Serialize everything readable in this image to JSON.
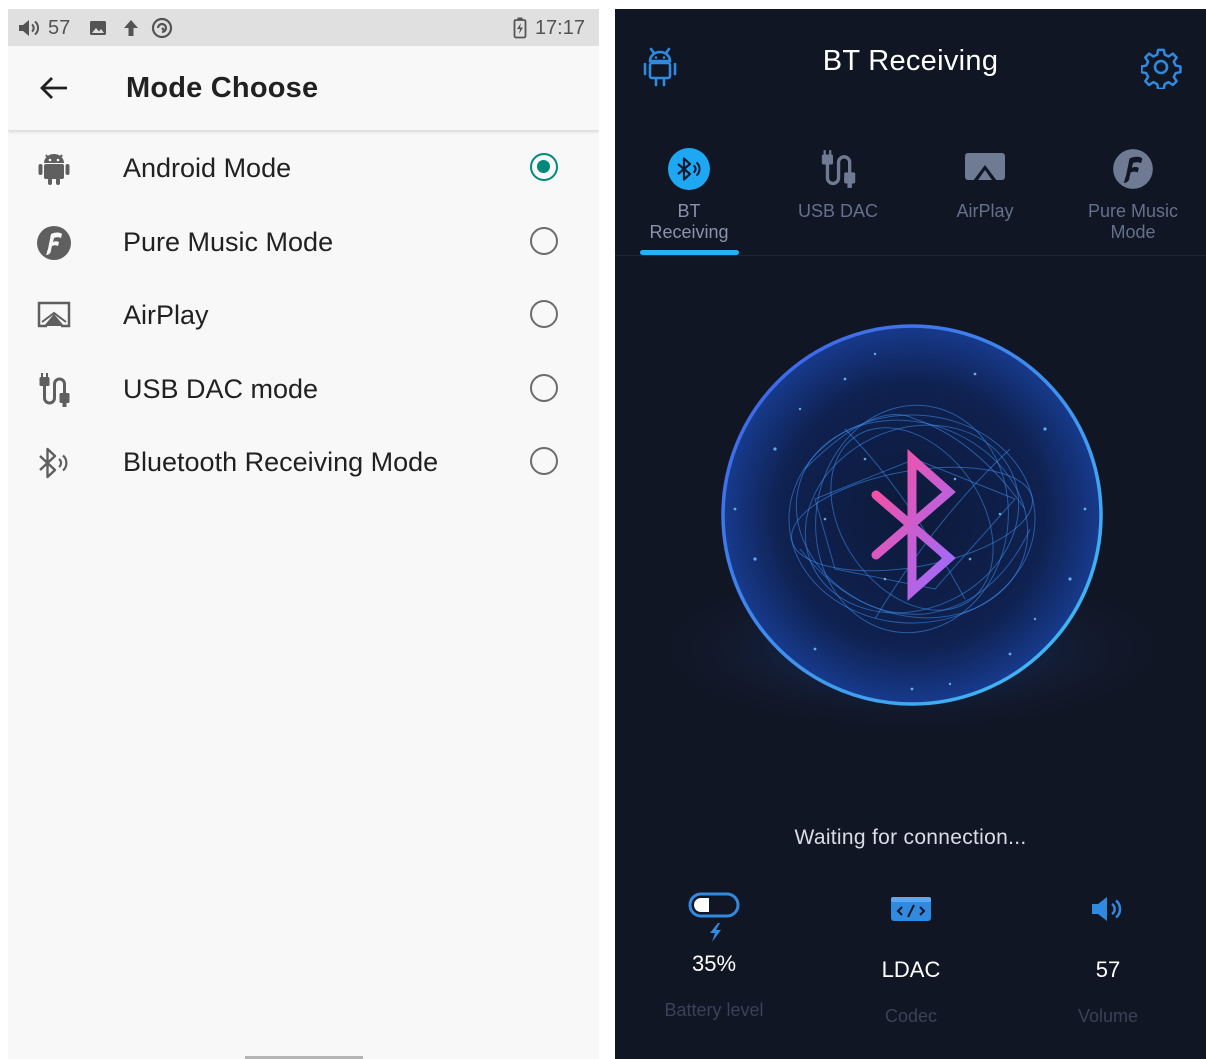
{
  "left_screen": {
    "status_bar": {
      "volume_level": "57",
      "time": "17:17"
    },
    "title": "Mode Choose",
    "modes": [
      {
        "label": "Android Mode",
        "icon": "android-icon",
        "selected": true
      },
      {
        "label": "Pure Music Mode",
        "icon": "pure-music-icon",
        "selected": false
      },
      {
        "label": "AirPlay",
        "icon": "airplay-icon",
        "selected": false
      },
      {
        "label": "USB DAC mode",
        "icon": "usb-dac-icon",
        "selected": false
      },
      {
        "label": "Bluetooth Receiving Mode",
        "icon": "bluetooth-receiving-icon",
        "selected": false
      }
    ],
    "accent_color": "#00897b"
  },
  "right_screen": {
    "title": "BT Receiving",
    "tabs": [
      {
        "line1": "BT",
        "line2": "Receiving",
        "icon": "bluetooth-receiving-icon",
        "active": true
      },
      {
        "line1": "USB DAC",
        "line2": "",
        "icon": "usb-dac-icon",
        "active": false
      },
      {
        "line1": "AirPlay",
        "line2": "",
        "icon": "airplay-icon",
        "active": false
      },
      {
        "line1": "Pure Music",
        "line2": "Mode",
        "icon": "pure-music-icon",
        "active": false
      }
    ],
    "status_text": "Waiting for connection...",
    "stats": {
      "battery": {
        "value": "35%",
        "label": "Battery level",
        "icon": "battery-charging-icon"
      },
      "codec": {
        "value": "LDAC",
        "label": "Codec",
        "icon": "codec-icon"
      },
      "volume": {
        "value": "57",
        "label": "Volume",
        "icon": "volume-icon"
      }
    },
    "accent_color": "#20b2f2",
    "background_color": "#111624"
  }
}
